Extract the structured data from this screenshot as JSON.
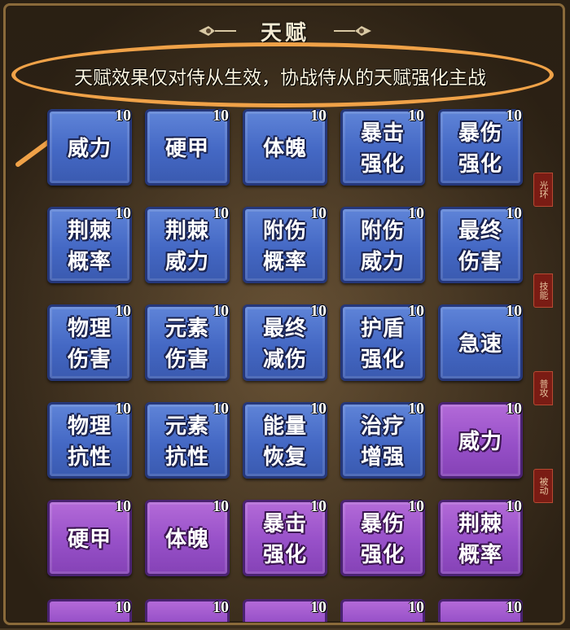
{
  "header": {
    "title": "天赋"
  },
  "notice": {
    "text": "天赋效果仅对侍从生效，协战侍从的天赋强化主战"
  },
  "colors": {
    "highlight": "#f0a248",
    "blue_tile": "#4468c4",
    "purple_tile": "#9750c8"
  },
  "talents": [
    {
      "label": "威力",
      "level": "10",
      "color": "blue"
    },
    {
      "label": "硬甲",
      "level": "10",
      "color": "blue"
    },
    {
      "label": "体魄",
      "level": "10",
      "color": "blue"
    },
    {
      "label": "暴击\n强化",
      "level": "10",
      "color": "blue"
    },
    {
      "label": "暴伤\n强化",
      "level": "10",
      "color": "blue"
    },
    {
      "label": "荆棘\n概率",
      "level": "10",
      "color": "blue"
    },
    {
      "label": "荆棘\n威力",
      "level": "10",
      "color": "blue"
    },
    {
      "label": "附伤\n概率",
      "level": "10",
      "color": "blue"
    },
    {
      "label": "附伤\n威力",
      "level": "10",
      "color": "blue"
    },
    {
      "label": "最终\n伤害",
      "level": "10",
      "color": "blue"
    },
    {
      "label": "物理\n伤害",
      "level": "10",
      "color": "blue"
    },
    {
      "label": "元素\n伤害",
      "level": "10",
      "color": "blue"
    },
    {
      "label": "最终\n减伤",
      "level": "10",
      "color": "blue"
    },
    {
      "label": "护盾\n强化",
      "level": "10",
      "color": "blue"
    },
    {
      "label": "急速",
      "level": "10",
      "color": "blue"
    },
    {
      "label": "物理\n抗性",
      "level": "10",
      "color": "blue"
    },
    {
      "label": "元素\n抗性",
      "level": "10",
      "color": "blue"
    },
    {
      "label": "能量\n恢复",
      "level": "10",
      "color": "blue"
    },
    {
      "label": "治疗\n增强",
      "level": "10",
      "color": "blue"
    },
    {
      "label": "威力",
      "level": "10",
      "color": "purple"
    },
    {
      "label": "硬甲",
      "level": "10",
      "color": "purple"
    },
    {
      "label": "体魄",
      "level": "10",
      "color": "purple"
    },
    {
      "label": "暴击\n强化",
      "level": "10",
      "color": "purple"
    },
    {
      "label": "暴伤\n强化",
      "level": "10",
      "color": "purple"
    },
    {
      "label": "荆棘\n概率",
      "level": "10",
      "color": "purple"
    }
  ],
  "partial_row_levels": [
    "10",
    "10",
    "10",
    "10",
    "10"
  ],
  "side_tabs": [
    "光环",
    "技能",
    "普攻",
    "被动"
  ]
}
